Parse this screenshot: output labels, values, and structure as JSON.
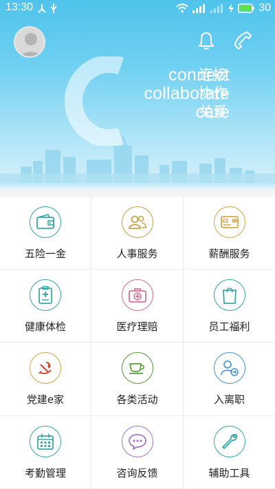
{
  "status_bar": {
    "time": "13:30",
    "battery": "30"
  },
  "banner": {
    "slogan_en": [
      "connect",
      "collaborate",
      "care"
    ],
    "slogan_cn": [
      "连接",
      "协作",
      "关爱"
    ]
  },
  "menu": [
    {
      "label": "五险一金",
      "icon": "wallet-icon",
      "color": "#3aa8a9"
    },
    {
      "label": "人事服务",
      "icon": "people-icon",
      "color": "#c9a24a"
    },
    {
      "label": "薪酬服务",
      "icon": "card-icon",
      "color": "#d6a84a"
    },
    {
      "label": "健康体检",
      "icon": "clipboard-medical-icon",
      "color": "#3aa8a9"
    },
    {
      "label": "医疗理赔",
      "icon": "medical-kit-icon",
      "color": "#d9708f"
    },
    {
      "label": "员工福利",
      "icon": "gift-bag-icon",
      "color": "#3aa8a9"
    },
    {
      "label": "党建e家",
      "icon": "party-emblem-icon",
      "color": "#d6a84a"
    },
    {
      "label": "各类活动",
      "icon": "coffee-cup-icon",
      "color": "#5a9c3a"
    },
    {
      "label": "入离职",
      "icon": "person-transfer-icon",
      "color": "#4b97d4"
    },
    {
      "label": "考勤管理",
      "icon": "calendar-icon",
      "color": "#3aa8a9"
    },
    {
      "label": "咨询反馈",
      "icon": "chat-bubble-icon",
      "color": "#a477c9"
    },
    {
      "label": "辅助工具",
      "icon": "wrench-icon",
      "color": "#3aa8a9"
    }
  ]
}
